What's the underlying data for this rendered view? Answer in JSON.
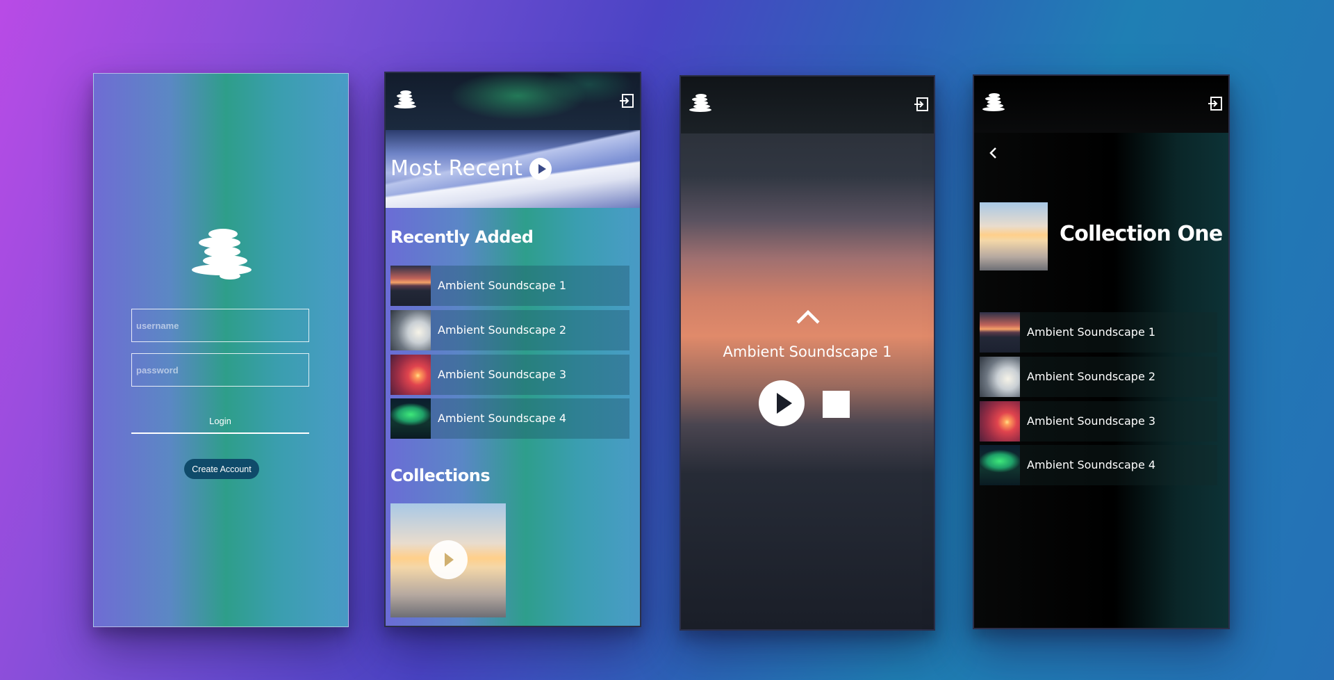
{
  "login": {
    "username_placeholder": "username",
    "password_placeholder": "password",
    "login_label": "Login",
    "create_account_label": "Create Account"
  },
  "home": {
    "most_recent_title": "Most Recent",
    "recently_added_title": "Recently Added",
    "tracks": [
      {
        "label": "Ambient Soundscape 1"
      },
      {
        "label": "Ambient Soundscape 2"
      },
      {
        "label": "Ambient Soundscape 3"
      },
      {
        "label": "Ambient Soundscape 4"
      }
    ],
    "collections_title": "Collections"
  },
  "player": {
    "track_title": "Ambient Soundscape 1"
  },
  "collection": {
    "title": "Collection One",
    "tracks": [
      {
        "label": "Ambient Soundscape 1"
      },
      {
        "label": "Ambient Soundscape 2"
      },
      {
        "label": "Ambient Soundscape 3"
      },
      {
        "label": "Ambient Soundscape 4"
      }
    ]
  },
  "icons": {
    "logo": "stacked-stones-logo-icon",
    "logout": "logout-icon",
    "play": "play-icon",
    "stop": "stop-icon",
    "expand": "chevron-up-icon",
    "back": "chevron-left-icon"
  },
  "colors": {
    "create_account_button": "#0f4b6a",
    "text": "#ffffff"
  }
}
